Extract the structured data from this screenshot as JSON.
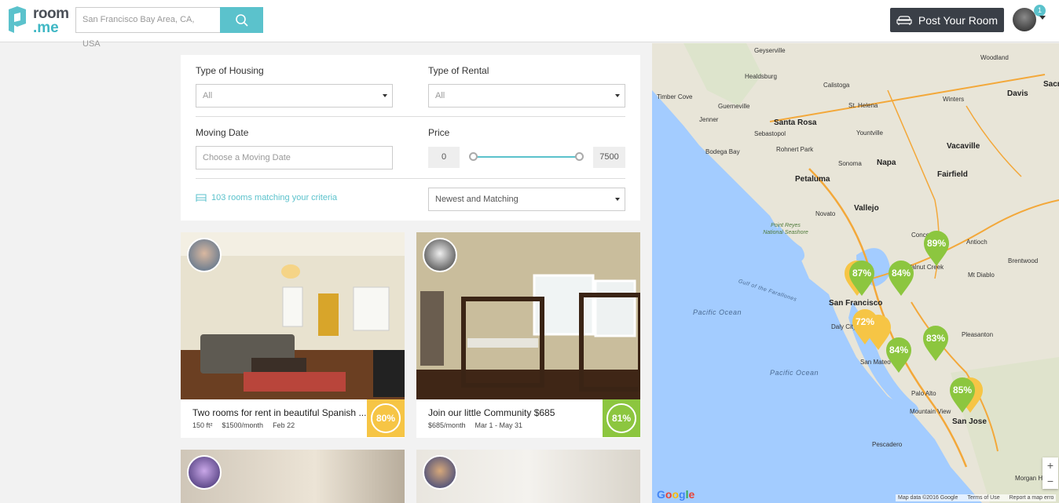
{
  "header": {
    "logo_line1": "room",
    "logo_line2": ".me",
    "search_placeholder": "San Francisco Bay Area, CA, USA",
    "post_button_label": "Post Your Room",
    "notification_count": "1"
  },
  "filters": {
    "housing_label": "Type of Housing",
    "housing_value": "All",
    "rental_label": "Type of Rental",
    "rental_value": "All",
    "moving_label": "Moving Date",
    "moving_placeholder": "Choose a Moving Date",
    "price_label": "Price",
    "price_min": "0",
    "price_max": "7500",
    "match_text": "103 rooms matching your criteria",
    "sort_value": "Newest and Matching"
  },
  "listings": [
    {
      "title": "Two rooms for rent in beautiful Spanish ...",
      "size": "150 ft²",
      "price": "$1500/month",
      "date": "Feb 22",
      "score": "80%",
      "score_color": "#f6c545"
    },
    {
      "title": "Join our little Community $685",
      "size": "",
      "price": "$685/month",
      "date": "Mar 1 - May 31",
      "score": "81%",
      "score_color": "#8cc63f"
    }
  ],
  "map": {
    "places": [
      "Geyserville",
      "Healdsburg",
      "Calistoga",
      "Timber Cove",
      "Guerneville",
      "St. Helena",
      "Yountville",
      "Santa Rosa",
      "Sebastopol",
      "Rohnert Park",
      "Bodega Bay",
      "Sonoma",
      "Napa",
      "Petaluma",
      "Fairfield",
      "Vacaville",
      "Davis",
      "Woodland",
      "Winters",
      "Vallejo",
      "Novato",
      "Concord",
      "Walnut Creek",
      "Antioch",
      "Brentwood",
      "Mt Diablo",
      "San Francisco",
      "Daly City",
      "San Mateo",
      "Pleasanton",
      "Palo Alto",
      "Mountain View",
      "San Jose",
      "Pescadero",
      "Morgan Hill",
      "Jenner",
      "Sacrar"
    ],
    "ocean_labels": [
      "Pacific Ocean",
      "Pacific Ocean",
      "Gulf of the Farallones",
      "Point Reyes National Seashore"
    ],
    "pins": [
      {
        "label": "87%",
        "color": "#8cc63f"
      },
      {
        "label": "84%",
        "color": "#8cc63f"
      },
      {
        "label": "89%",
        "color": "#8cc63f"
      },
      {
        "label": "72%",
        "color": "#f6c545"
      },
      {
        "label": "84%",
        "color": "#8cc63f"
      },
      {
        "label": "83%",
        "color": "#8cc63f"
      },
      {
        "label": "85%",
        "color": "#8cc63f"
      }
    ],
    "google": "Google",
    "map_data": "Map data ©2016 Google",
    "terms": "Terms of Use",
    "report": "Report a map erro"
  }
}
